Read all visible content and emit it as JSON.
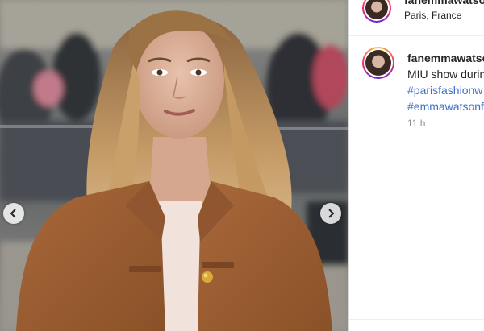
{
  "post": {
    "username": "fanemmawatso",
    "location": "Paris, France",
    "caption": "MIU show durin",
    "hashtags": [
      "#parisfashionw",
      "#emmawatsonf"
    ],
    "time": "11 h"
  },
  "photo": {
    "description_icon": "photo-of-woman-in-suede-jacket",
    "accent": "#3f6fc9"
  }
}
